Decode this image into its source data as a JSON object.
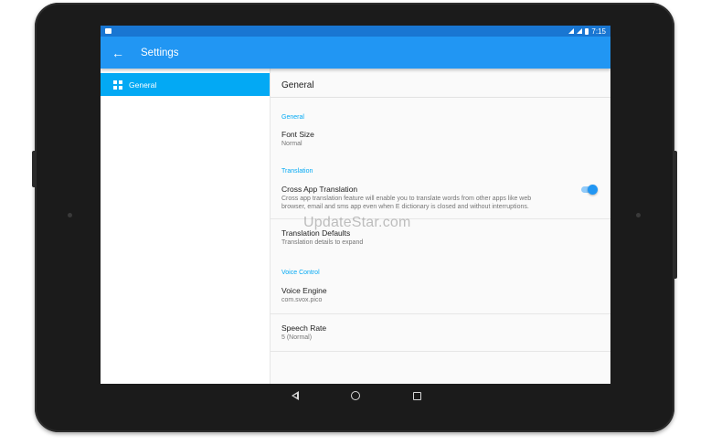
{
  "status_bar": {
    "time": "7:15"
  },
  "app_bar": {
    "title": "Settings",
    "back_icon": "arrow-left-icon"
  },
  "sidebar": {
    "items": [
      {
        "label": "General",
        "icon": "dashboard-grid-icon",
        "selected": true
      }
    ]
  },
  "detail": {
    "header": "General",
    "sections": [
      {
        "title": "General",
        "items": [
          {
            "title": "Font Size",
            "summary": "Normal"
          }
        ]
      },
      {
        "title": "Translation",
        "items": [
          {
            "title": "Cross App Translation",
            "summary": "Cross app translation feature will enable you to translate words from other apps like web browser, email and sms app even when E dictionary is closed and without interruptions.",
            "toggle": true
          },
          {
            "title": "Translation Defaults",
            "summary": "Translation details to expand"
          }
        ]
      },
      {
        "title": "Voice Control",
        "items": [
          {
            "title": "Voice Engine",
            "summary": "com.svox.pico"
          },
          {
            "title": "Speech Rate",
            "summary": "5 (Normal)"
          }
        ]
      }
    ]
  },
  "watermark": "UpdateStar.com",
  "colors": {
    "status_bar": "#1976d2",
    "app_bar": "#2196f3",
    "accent": "#03a9f4",
    "toggle_thumb": "#2196f3",
    "toggle_track": "#90caf9"
  }
}
